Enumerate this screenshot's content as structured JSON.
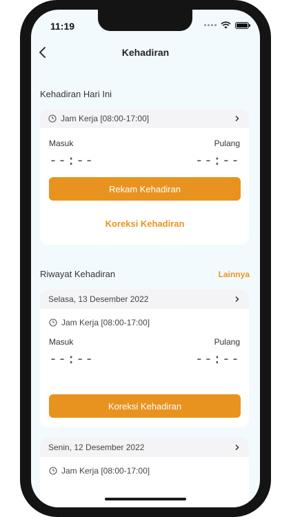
{
  "status": {
    "time": "11:19"
  },
  "nav": {
    "title": "Kehadiran"
  },
  "today": {
    "section_title": "Kehadiran Hari Ini",
    "work_hours": "Jam Kerja [08:00-17:00]",
    "in_label": "Masuk",
    "out_label": "Pulang",
    "in_value": "--:--",
    "out_value": "--:--",
    "primary_button": "Rekam Kehadiran",
    "secondary_button": "Koreksi Kehadiran"
  },
  "history": {
    "section_title": "Riwayat Kehadiran",
    "more_link": "Lainnya",
    "items": [
      {
        "date": "Selasa, 13 Desember 2022",
        "work_hours": "Jam Kerja [08:00-17:00]",
        "in_label": "Masuk",
        "out_label": "Pulang",
        "in_value": "--:--",
        "out_value": "--:--",
        "button": "Koreksi Kehadiran"
      },
      {
        "date": "Senin, 12 Desember 2022",
        "work_hours": "Jam Kerja [08:00-17:00]"
      }
    ]
  },
  "colors": {
    "accent": "#e8931f",
    "background": "#f3fafe"
  }
}
